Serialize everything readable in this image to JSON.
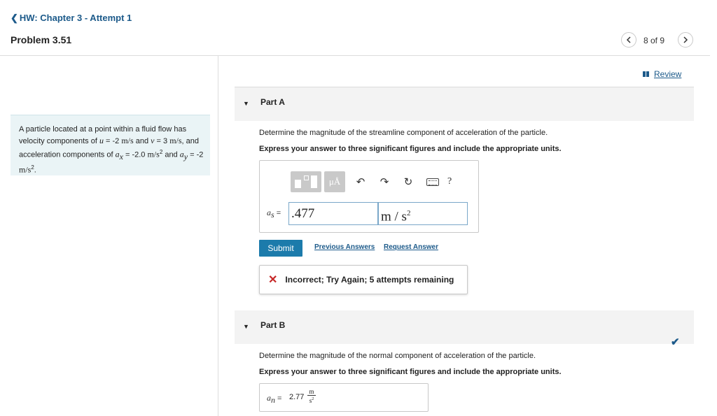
{
  "header": {
    "back_chevron": "❮",
    "hw_title": "HW: Chapter 3 - Attempt 1",
    "problem_title": "Problem 3.51",
    "pager": "8 of 9",
    "prev_icon": "chevron-left-icon",
    "next_icon": "chevron-right-icon"
  },
  "problem": {
    "t1": "A particle located at a point within a fluid flow has velocity components of ",
    "u_var": "u",
    "t2": " = -2 ",
    "u_unit": "m/s",
    "t3": " and ",
    "v_var": "v",
    "t4": " = 3 ",
    "v_unit": "m/s",
    "t5": ", and acceleration components of ",
    "ax_var": "a",
    "ax_sub": "x",
    "t6": " = -2.0 ",
    "ax_unit": "m/s",
    "ax_exp": "2",
    "t7": " and ",
    "ay_var": "a",
    "ay_sub": "y",
    "t8": " = -2 ",
    "ay_unit": "m/s",
    "ay_exp": "2",
    "t9": "."
  },
  "review": {
    "label": "Review"
  },
  "partA": {
    "title": "Part A",
    "instruction": "Determine the magnitude of the streamline component of acceleration of the particle.",
    "hint": "Express your answer to three significant figures and include the appropriate units.",
    "toolbar": {
      "units_glyph": "μÅ",
      "undo_glyph": "↶",
      "redo_glyph": "↷",
      "reset_glyph": "↻",
      "help_glyph": "?"
    },
    "answer_var": "a",
    "answer_sub": "s",
    "answer_eq": " =",
    "value": ".477",
    "units_base": "m / s",
    "units_exp": "2",
    "submit_label": "Submit",
    "previous_answers_label": "Previous Answers",
    "request_answer_label": "Request Answer",
    "feedback_icon": "✕",
    "feedback_text": "Incorrect; Try Again; 5 attempts remaining"
  },
  "partB": {
    "title": "Part B",
    "check_glyph": "✔",
    "instruction": "Determine the magnitude of the normal component of acceleration of the particle.",
    "hint": "Express your answer to three significant figures and include the appropriate units.",
    "answer_var": "a",
    "answer_sub": "n",
    "answer_eq": " =",
    "value": "2.77",
    "unit_num": "m",
    "unit_den": "s",
    "unit_den_exp": "2"
  },
  "colors": {
    "link": "#1c5a8a",
    "submit": "#1c7bab",
    "problem_bg": "#eaf4f6",
    "part_header_bg": "#f3f3f3",
    "error": "#c62828"
  }
}
